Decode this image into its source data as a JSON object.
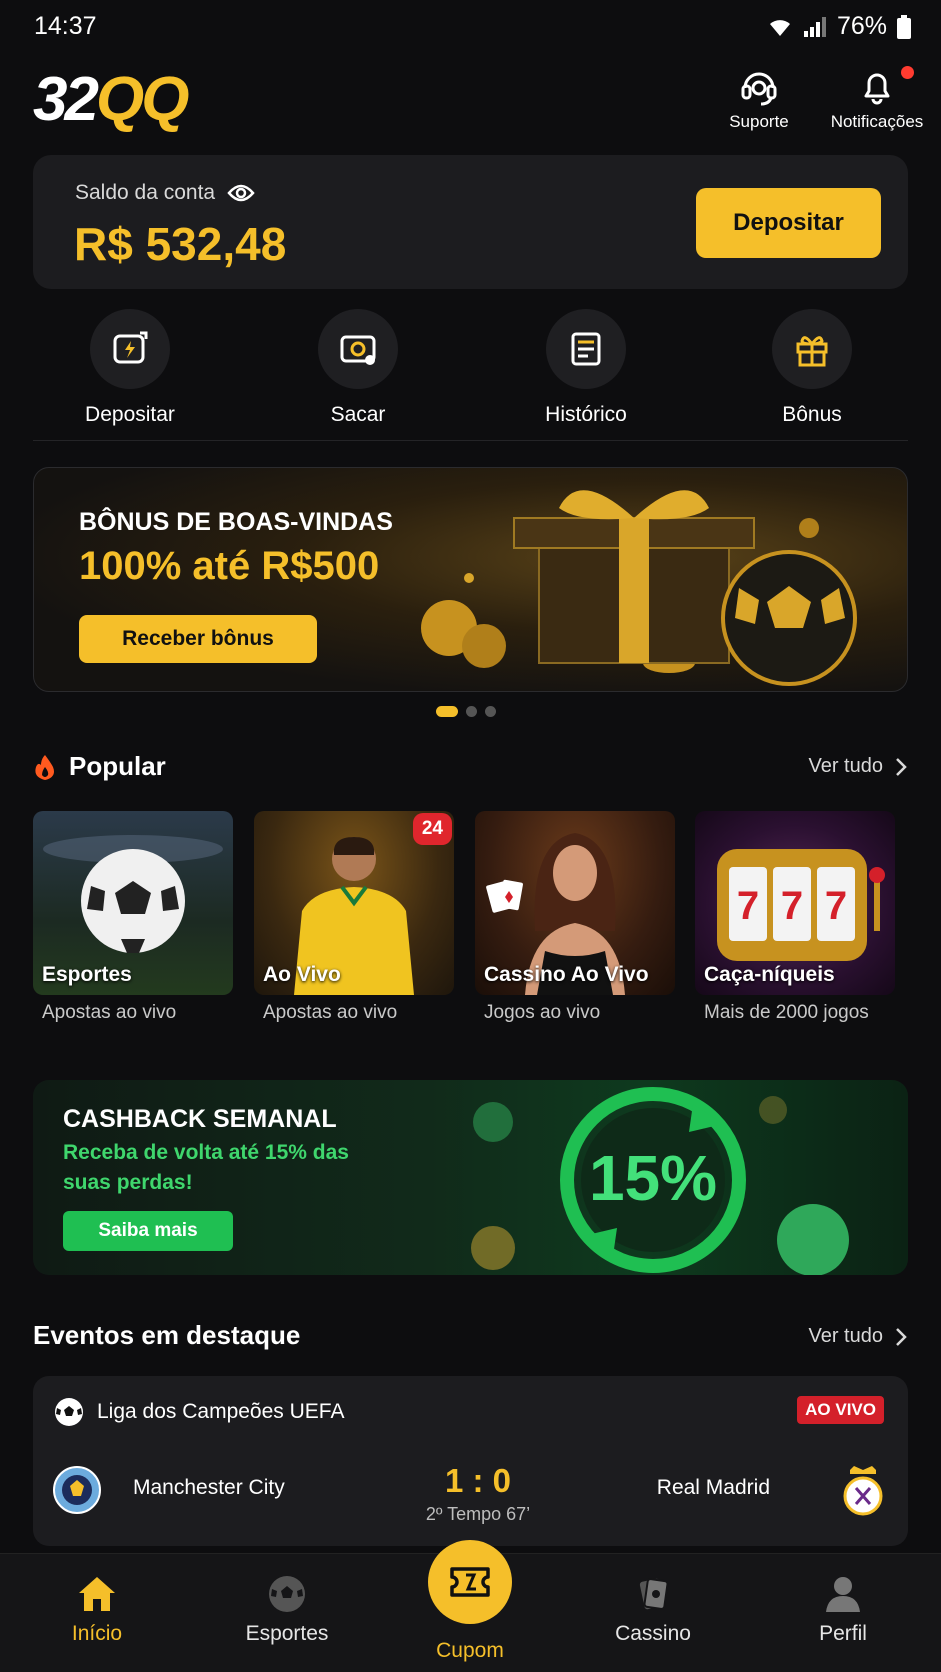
{
  "status": {
    "time": "14:37",
    "battery": "76%"
  },
  "header": {
    "logo_a": "32",
    "logo_b": "QQ",
    "support": "Suporte",
    "notifications": "Notificações"
  },
  "balance": {
    "label": "Saldo da conta",
    "amount": "R$ 532,48",
    "deposit_button": "Depositar"
  },
  "quick_actions": [
    {
      "label": "Depositar",
      "icon": "deposit-icon"
    },
    {
      "label": "Sacar",
      "icon": "withdraw-icon"
    },
    {
      "label": "Histórico",
      "icon": "history-icon"
    },
    {
      "label": "Bônus",
      "icon": "gift-icon"
    }
  ],
  "promo": {
    "line1": "BÔNUS DE BOAS-VINDAS",
    "line2": "100% até R$500",
    "button": "Receber bônus",
    "active_slide": 1,
    "slides": 3
  },
  "popular": {
    "title": "Popular",
    "see_all": "Ver tudo",
    "cards": [
      {
        "name": "Esportes",
        "sub": "Apostas ao vivo"
      },
      {
        "name": "Ao Vivo",
        "sub": "Apostas ao vivo",
        "badge": "24"
      },
      {
        "name": "Cassino Ao Vivo",
        "sub": "Jogos ao vivo"
      },
      {
        "name": "Caça-níqueis",
        "sub": "Mais de 2000 jogos"
      }
    ]
  },
  "cashback": {
    "title": "CASHBACK SEMANAL",
    "text": "Receba de volta até 15% das suas perdas!",
    "button": "Saiba mais",
    "graphic": "15%"
  },
  "events": {
    "title": "Eventos em destaque",
    "see_all": "Ver tudo",
    "featured": {
      "league": "Liga dos Campeões UEFA",
      "status": "AO VIVO",
      "home": "Manchester City",
      "away": "Real Madrid",
      "score": "1 : 0",
      "period": "2º Tempo 67’"
    }
  },
  "nav": {
    "items": [
      "Início",
      "Esportes",
      "Cupom",
      "Cassino",
      "Perfil"
    ],
    "active": "Início"
  },
  "colors": {
    "accent": "#f5bf2a",
    "green": "#1fbf52",
    "live": "#d4202a",
    "bg": "#0d0d0f"
  }
}
